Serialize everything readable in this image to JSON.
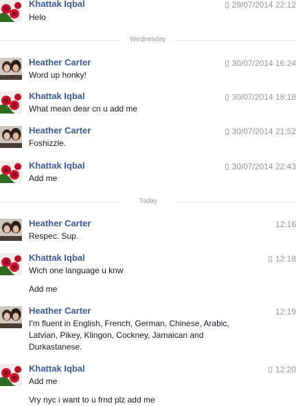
{
  "messages": [
    {
      "sender": "Khattak Iqbal",
      "avatar": "red-roses-avatar-icon",
      "mobile": true,
      "time": "29/07/2014 22:12",
      "lines": [
        "Helo"
      ]
    },
    {
      "sender": "Heather Carter",
      "avatar": "couple-photo-avatar-icon",
      "mobile": true,
      "time": "30/07/2014 16:24",
      "lines": [
        "Word up honky!"
      ]
    },
    {
      "sender": "Khattak Iqbal",
      "avatar": "red-roses-avatar-icon",
      "mobile": true,
      "time": "30/07/2014 18:18",
      "lines": [
        "What mean dear cn u add me"
      ]
    },
    {
      "sender": "Heather Carter",
      "avatar": "couple-photo-avatar-icon",
      "mobile": true,
      "time": "30/07/2014 21:52",
      "lines": [
        "Foshizzle."
      ]
    },
    {
      "sender": "Khattak Iqbal",
      "avatar": "red-roses-avatar-icon",
      "mobile": true,
      "time": "30/07/2014 22:43",
      "lines": [
        "Add me"
      ]
    },
    {
      "sender": "Heather Carter",
      "avatar": "couple-photo-avatar-icon",
      "mobile": false,
      "time": "12:16",
      "lines": [
        "Respec. Sup."
      ]
    },
    {
      "sender": "Khattak Iqbal",
      "avatar": "red-roses-avatar-icon",
      "mobile": true,
      "time": "12:18",
      "lines": [
        "Wich one language u knw",
        "Add me"
      ]
    },
    {
      "sender": "Heather Carter",
      "avatar": "couple-photo-avatar-icon",
      "mobile": false,
      "time": "12:19",
      "lines": [
        "I'm fluent in English, French, German, Chinese, Arabic, Latvian, Pikey, Klingon, Cockney, Jamaican and Durkastanese."
      ]
    },
    {
      "sender": "Khattak Iqbal",
      "avatar": "red-roses-avatar-icon",
      "mobile": true,
      "time": "12:20",
      "lines": [
        "Add me",
        "Vry nyc i want to u frnd plz add me"
      ]
    }
  ],
  "dividers": [
    {
      "label": "Wednesday"
    },
    {
      "label": "Today"
    }
  ],
  "colors": {
    "sender_name": "#3b5998",
    "body_text": "#141823",
    "meta_text": "#9197a3",
    "divider_rule": "#e5e5e5"
  }
}
